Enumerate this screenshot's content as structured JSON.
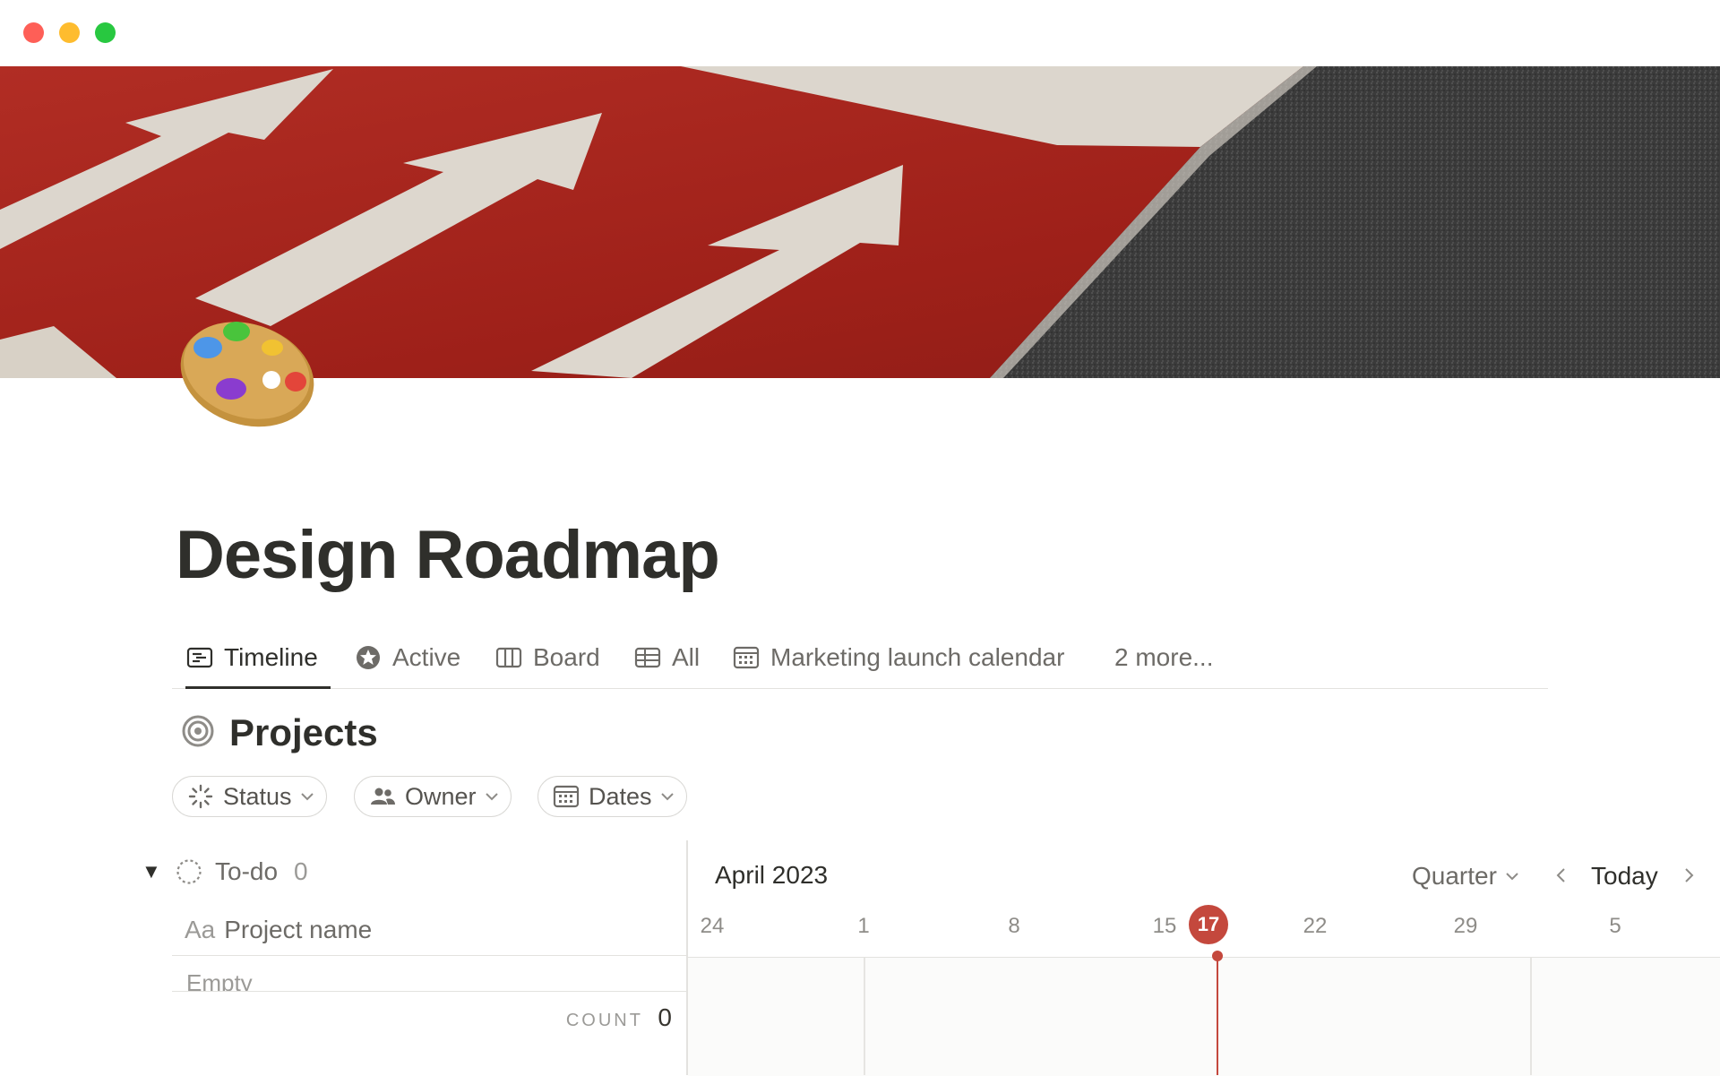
{
  "page": {
    "title": "Design Roadmap",
    "icon": "artist-palette-icon",
    "cover": "road-arrows-cover-image"
  },
  "tabs": [
    {
      "label": "Timeline",
      "icon": "timeline-icon",
      "active": true
    },
    {
      "label": "Active",
      "icon": "star-badge-icon"
    },
    {
      "label": "Board",
      "icon": "board-columns-icon"
    },
    {
      "label": "All",
      "icon": "table-icon"
    },
    {
      "label": "Marketing launch calendar",
      "icon": "calendar-icon"
    },
    {
      "label": "2 more..."
    }
  ],
  "section": {
    "title": "Projects",
    "icon": "target-icon"
  },
  "filters": [
    {
      "label": "Status",
      "icon": "status-spinner-icon"
    },
    {
      "label": "Owner",
      "icon": "people-icon"
    },
    {
      "label": "Dates",
      "icon": "calendar-icon"
    }
  ],
  "group": {
    "toggle": "▼",
    "status": "To-do",
    "count": "0",
    "property_prefix": "Aa",
    "property_name": "Project name",
    "empty_text": "Empty",
    "count_label": "COUNT",
    "count_value": "0"
  },
  "timeline": {
    "month": "April 2023",
    "range": "Quarter",
    "today_label": "Today",
    "dates": [
      "24",
      "1",
      "8",
      "15",
      "17",
      "22",
      "29",
      "5"
    ],
    "today_date": "17"
  },
  "colors": {
    "accent_today": "#c4483d",
    "text": "#2f2f2b",
    "muted": "#6d6b67"
  }
}
